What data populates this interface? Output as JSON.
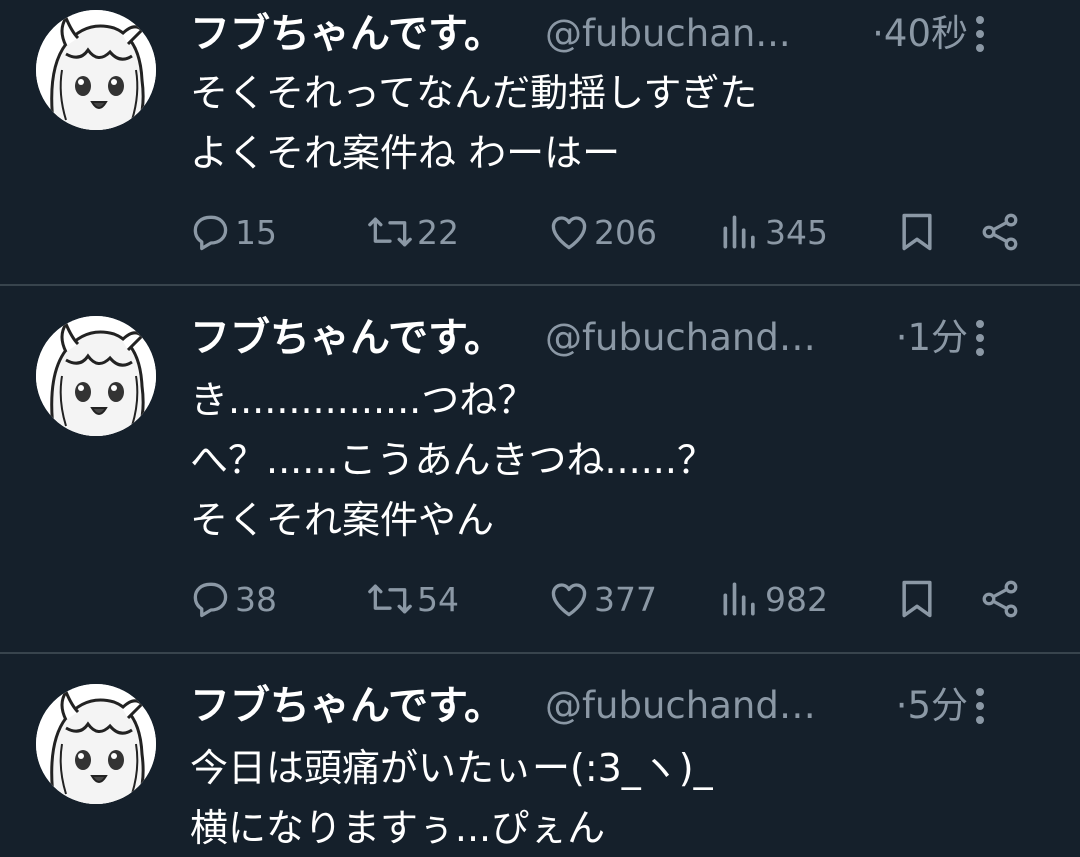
{
  "tweets": [
    {
      "name": "フブちゃんです。",
      "handle": "@fubuchan...",
      "time": "40秒",
      "lines": [
        "そくそれってなんだ動揺しすぎた",
        "よくそれ案件ね わーはー"
      ],
      "stats": {
        "replies": "15",
        "retweets": "22",
        "likes": "206",
        "views": "345"
      }
    },
    {
      "name": "フブちゃんです。",
      "handle": "@fubuchanda...",
      "time": "1分",
      "lines": [
        "き................つね？",
        "へ？......こうあんきつね......？",
        "そくそれ案件やん"
      ],
      "stats": {
        "replies": "38",
        "retweets": "54",
        "likes": "377",
        "views": "982"
      }
    },
    {
      "name": "フブちゃんです。",
      "handle": "@fubuchanda...",
      "time": "5分",
      "lines": [
        "今日は頭痛がいたぃー(:3_ヽ)_",
        "横になりますぅ...ぴぇん"
      ],
      "stats": {
        "replies": "",
        "retweets": "",
        "likes": "",
        "views": ""
      }
    }
  ],
  "separator": "·",
  "icons": {
    "reply": "reply-icon",
    "retweet": "retweet-icon",
    "like": "like-icon",
    "views": "views-icon",
    "bookmark": "bookmark-icon",
    "share": "share-icon",
    "more": "more-icon"
  },
  "colors": {
    "background": "#15202b",
    "text": "#ffffff",
    "secondary": "#8b98a5",
    "divider": "#38444d"
  }
}
